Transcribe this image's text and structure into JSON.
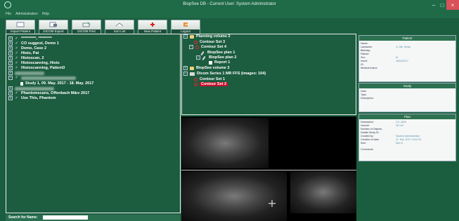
{
  "window": {
    "title": "BiopSee DB - Current User: System Administrator",
    "controls": {
      "minimize": "–",
      "maximize": "□",
      "close": "×"
    }
  },
  "menu": {
    "items": [
      "File",
      "Administration",
      "Help"
    ]
  },
  "toolbar": {
    "buttons": [
      {
        "label": "Import Patient",
        "icon": "import-icon"
      },
      {
        "label": "DICOM Export",
        "icon": "export-icon"
      },
      {
        "label": "DICOM Print",
        "icon": "print-icon"
      },
      {
        "label": "Sort List",
        "icon": "sort-icon"
      },
      {
        "label": "New Patient",
        "icon": "new-patient-icon"
      },
      {
        "label": "Logout",
        "icon": "logout-icon"
      }
    ]
  },
  "patients": {
    "rows": [
      {
        "text": "**********, *********",
        "sex": "♂"
      },
      {
        "text": "CO suggest, Demo 1",
        "sex": "♂"
      },
      {
        "text": "Demo, Case 2",
        "sex": "♂"
      },
      {
        "text": "Histo, Pat",
        "sex": "♂"
      },
      {
        "text": "Histoscan, 2",
        "sex": "♂"
      },
      {
        "text": "Histoscanning, Histo",
        "sex": "♂"
      },
      {
        "text": "Histoscanning, Patient3",
        "sex": "♂"
      }
    ],
    "blurred_rows": 2,
    "study_row": {
      "text": "Study 1, 09. May. 2017 - 18. May. 2017"
    },
    "rows_after": [
      {
        "text": "Phantomscans, Offenbach März 2017",
        "sex": "♂"
      },
      {
        "text": "Use This, Phantom",
        "sex": "♂"
      }
    ]
  },
  "search": {
    "label": "Search for Name:",
    "value": ""
  },
  "study_tree": [
    {
      "text": "Planning volume 2",
      "type": "book",
      "level": 0,
      "toggle": "−"
    },
    {
      "text": "Contour Set 3",
      "type": "contour",
      "level": 1
    },
    {
      "text": "Contour Set 4",
      "type": "contour",
      "level": 1,
      "toggle": "−"
    },
    {
      "text": "BiopSee plan 1",
      "type": "plan",
      "level": 2
    },
    {
      "text": "BiopSee plan 2",
      "type": "plan",
      "level": 2,
      "toggle": "−"
    },
    {
      "text": "Report 1",
      "type": "report",
      "level": 3
    },
    {
      "text": "BiopSee volume 3",
      "type": "book",
      "level": 0
    },
    {
      "text": "Dicom Series 1 MR FFS  (images: 104)",
      "type": "series",
      "level": 0,
      "toggle": "−"
    },
    {
      "text": "Contour Set 1",
      "type": "contour",
      "level": 1
    },
    {
      "text": "Contour Set 2",
      "type": "contour",
      "level": 1,
      "selected": true
    }
  ],
  "info_panels": {
    "patient": {
      "title": "Patient",
      "fields": [
        {
          "k": "Name:",
          "v": ""
        },
        {
          "k": "Lastname:",
          "v": "-fr, Bic, Bewe"
        },
        {
          "k": "Birthday:",
          "v": ""
        },
        {
          "k": "Patient:",
          "v": ""
        },
        {
          "k": "Sex:",
          "v": "M"
        },
        {
          "k": "Insert:",
          "v": "18/04/2017"
        },
        {
          "k": "ID:",
          "v": ""
        },
        {
          "k": "Medical Indica:",
          "v": ""
        }
      ]
    },
    "study": {
      "title": "Study",
      "fields": [
        {
          "k": "Date:",
          "v": ""
        },
        {
          "k": "Type:",
          "v": ""
        },
        {
          "k": "Description:",
          "v": ""
        }
      ]
    },
    "plan": {
      "title": "Plan",
      "fields": [
        {
          "k": "Description:",
          "v": "CS_3000"
        },
        {
          "k": "Volume:",
          "v": "30 cm³"
        },
        {
          "k": "Number of Objects:",
          "v": ""
        },
        {
          "k": "Details Study ID:",
          "v": ""
        },
        {
          "k": "Created by:",
          "v": "System Administrator"
        },
        {
          "k": "Creation of date:",
          "v": "11. Mai. 2017 13:42:31"
        },
        {
          "k": "Size:",
          "v": "Mai 11"
        },
        {
          "k": "Comments:",
          "v": ""
        }
      ]
    }
  },
  "colors": {
    "background": "#1b5e3f",
    "selected": "#c8102e",
    "accent": "#2d7150"
  }
}
